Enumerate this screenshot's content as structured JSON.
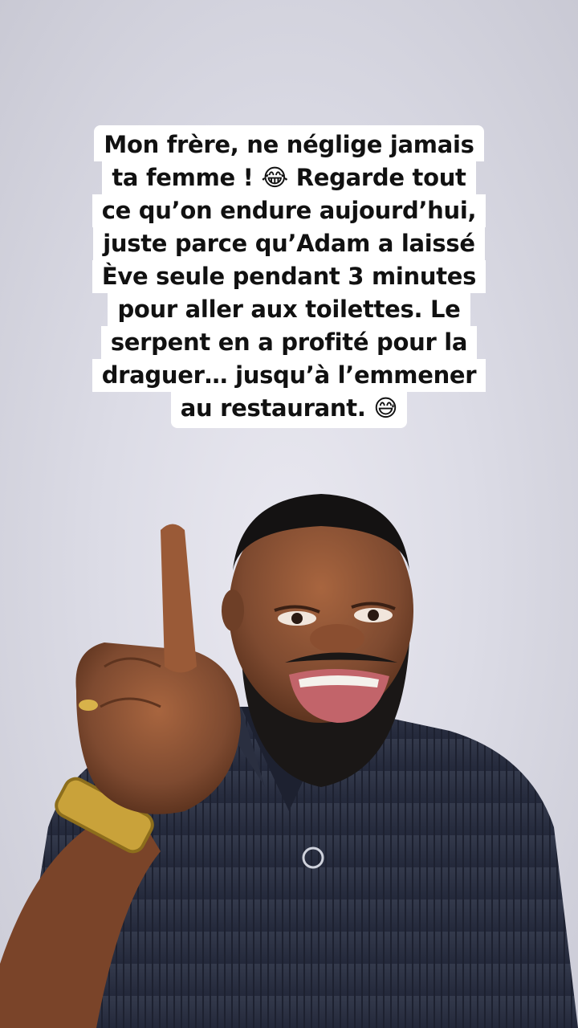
{
  "caption": {
    "lines": [
      "Mon frère, ne néglige jamais",
      "ta femme ! 😂 Regarde tout",
      "ce qu’on endure aujourd’hui,",
      "juste parce qu’Adam a laissé",
      "Ève seule pendant 3 minutes",
      "pour aller aux toilettes. Le",
      "serpent en a profité pour la",
      "draguer… jusqu’à l’emmener",
      "au restaurant. 😅"
    ]
  },
  "colors": {
    "background": "#dcdce6",
    "caption_bg": "#ffffff",
    "caption_text": "#111111",
    "shirt": "#2c3140",
    "skin": "#8a5236"
  }
}
